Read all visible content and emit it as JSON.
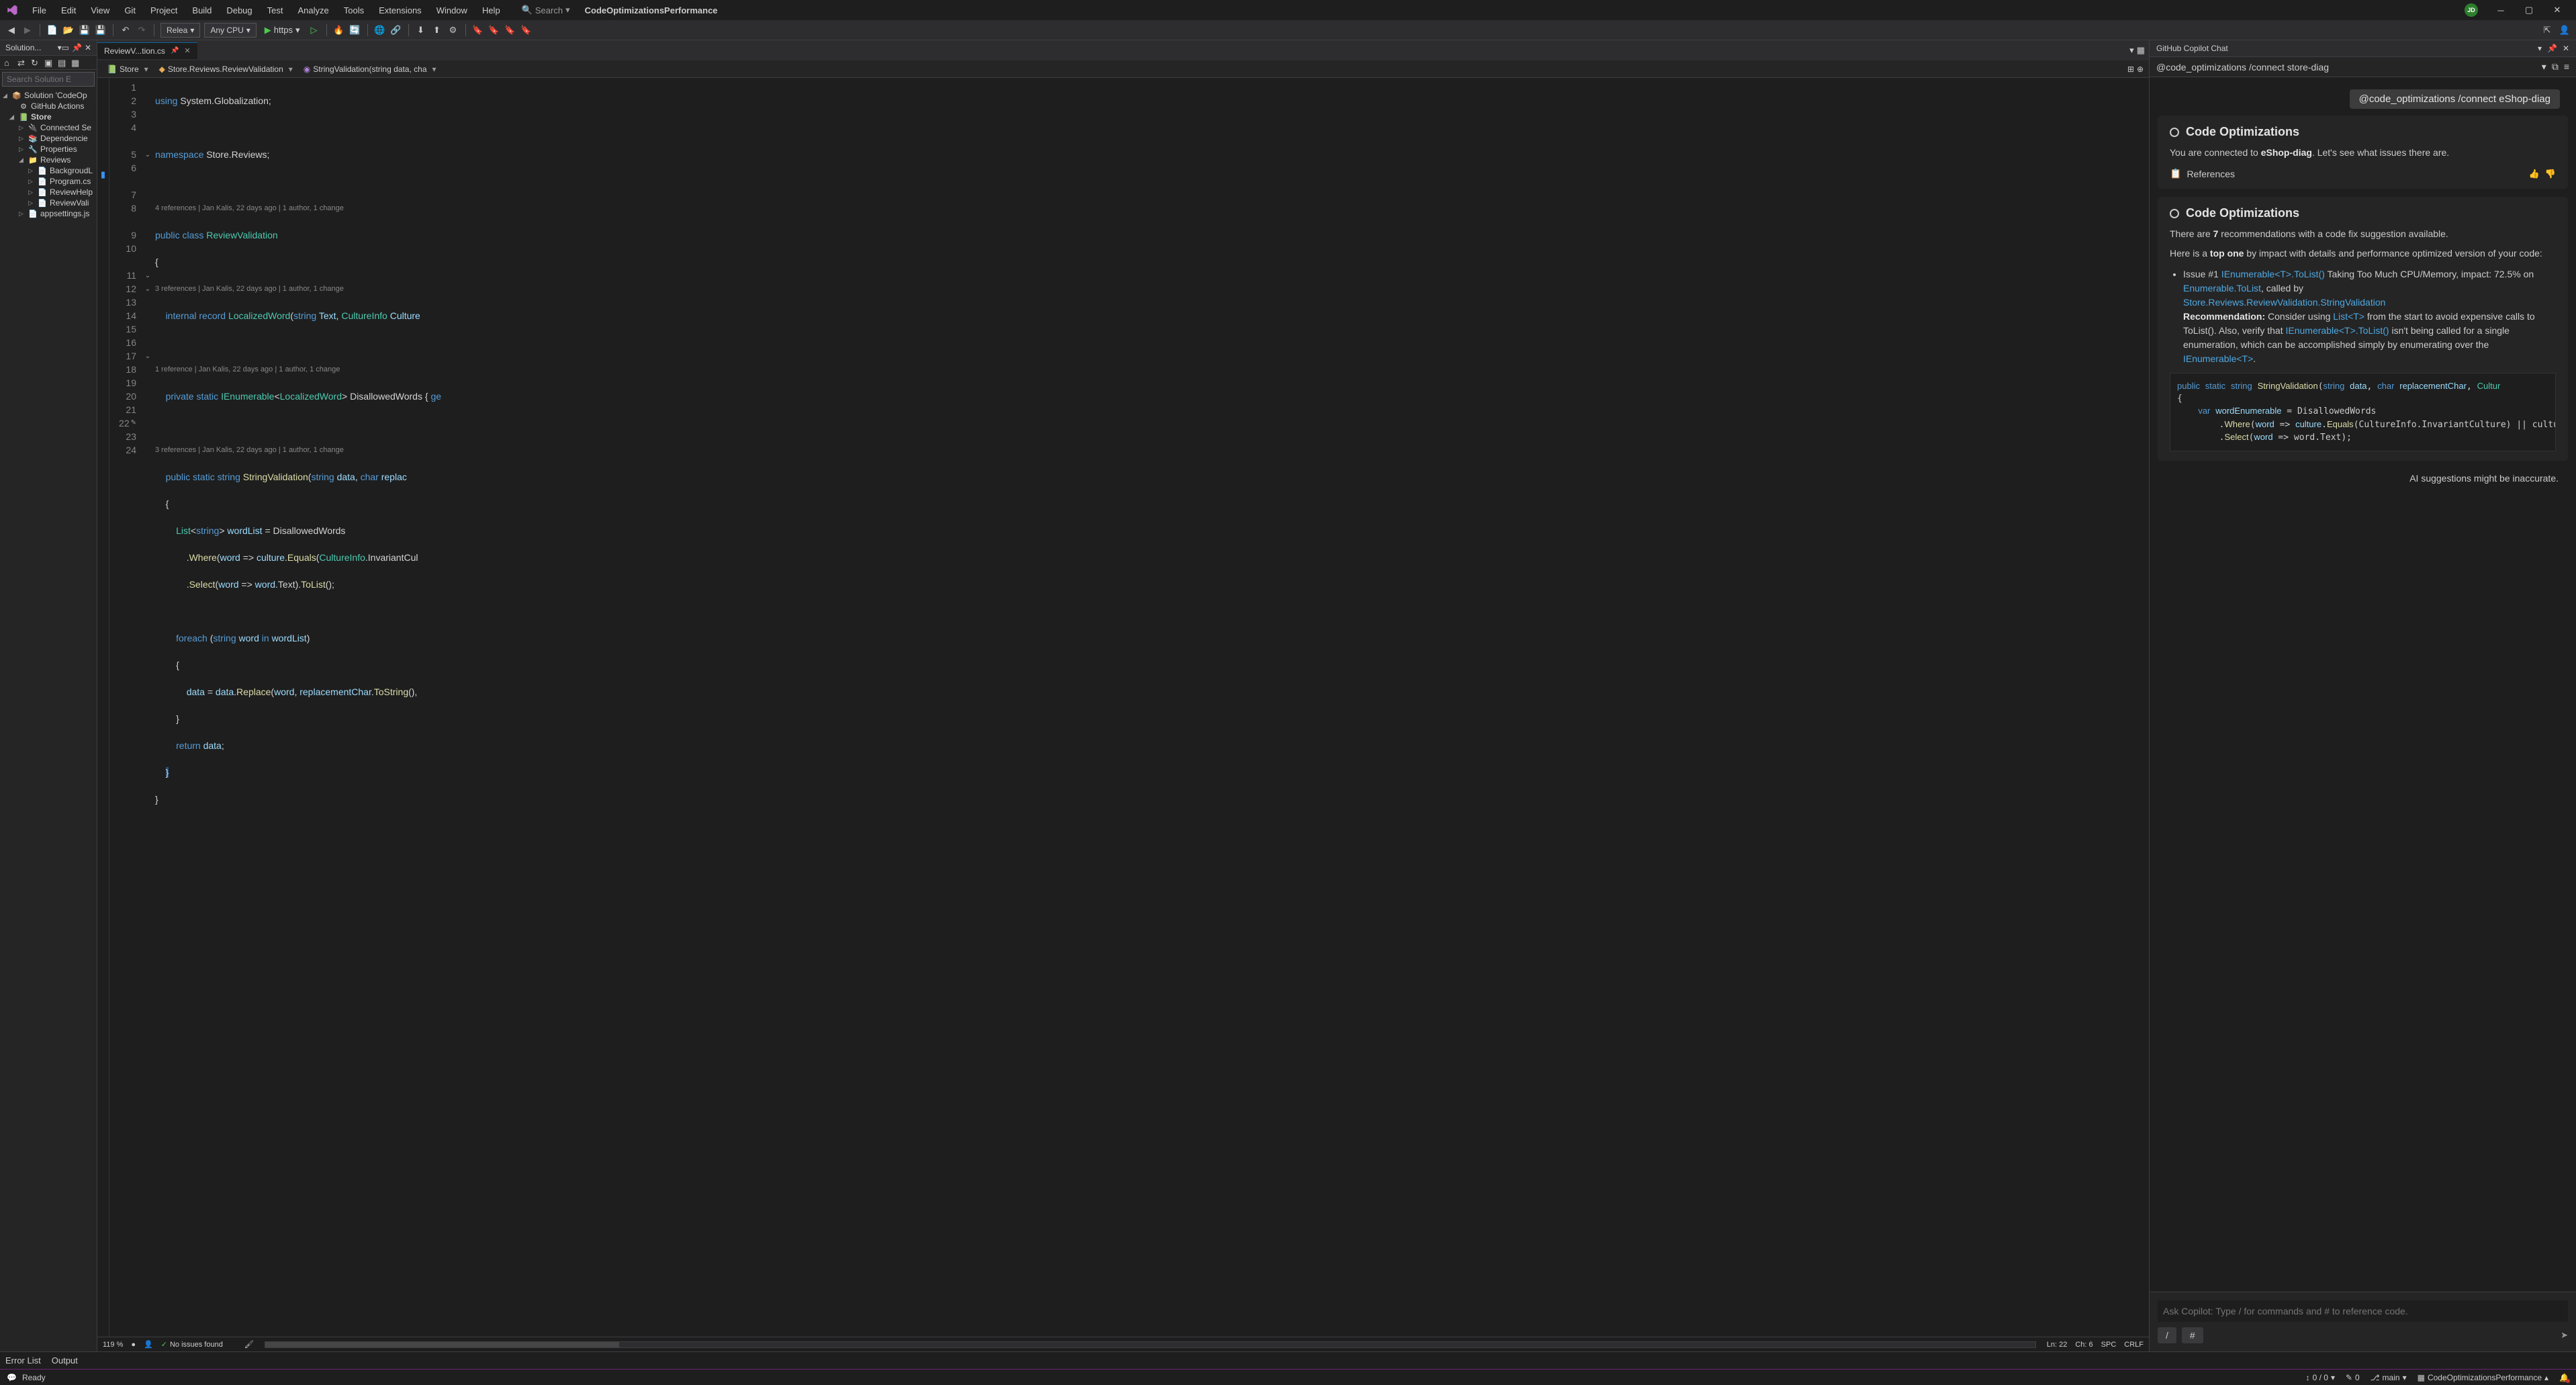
{
  "title_bar": {
    "menus": [
      "File",
      "Edit",
      "View",
      "Git",
      "Project",
      "Build",
      "Debug",
      "Test",
      "Analyze",
      "Tools",
      "Extensions",
      "Window",
      "Help"
    ],
    "search_placeholder": "Search",
    "project_name": "CodeOptimizationsPerformance",
    "user_initials": "JD"
  },
  "toolbar": {
    "config": "Relea",
    "platform": "Any CPU",
    "run_target": "https"
  },
  "solution_explorer": {
    "title": "Solution...",
    "search_placeholder": "Search Solution E",
    "solution": "Solution 'CodeOp",
    "github_actions": "GitHub Actions",
    "store": "Store",
    "connected": "Connected Se",
    "dependencies": "Dependencie",
    "properties": "Properties",
    "reviews": "Reviews",
    "background": "BackgroudL",
    "program": "Program.cs",
    "reviewhelp": "ReviewHelp",
    "reviewvali": "ReviewVali",
    "appsettings": "appsettings.js"
  },
  "editor": {
    "tab_name": "ReviewV...tion.cs",
    "breadcrumb1": "Store",
    "breadcrumb2": "Store.Reviews.ReviewValidation",
    "breadcrumb3": "StringValidation(string data, cha",
    "zoom": "119 %",
    "no_issues": "No issues found",
    "cursor_ln": "Ln: 22",
    "cursor_ch": "Ch: 6",
    "spaces": "SPC",
    "lineending": "CRLF",
    "codelens1": "4 references | Jan Kalis, 22 days ago | 1 author, 1 change",
    "codelens2": "3 references | Jan Kalis, 22 days ago | 1 author, 1 change",
    "codelens3": "1 reference | Jan Kalis, 22 days ago | 1 author, 1 change",
    "codelens4": "3 references | Jan Kalis, 22 days ago | 1 author, 1 change"
  },
  "copilot": {
    "title": "GitHub Copilot Chat",
    "prompt": "@code_optimizations /connect store-diag",
    "chip": "@code_optimizations /connect eShop-diag",
    "section_title": "Code Optimizations",
    "connected_pre": "You are connected to ",
    "connected_target": "eShop-diag",
    "connected_post": ". Let's see what issues there are.",
    "references": "References",
    "recs_pre": "There are ",
    "recs_count": "7",
    "recs_post": " recommendations with a code fix suggestion available.",
    "topone_pre": "Here is a ",
    "topone_bold": "top one",
    "topone_post": " by impact with details and performance optimized version of your code:",
    "issue_label": "Issue #1 ",
    "issue_api": "IEnumerable<T>.ToList()",
    "issue_text1": " Taking Too Much CPU/Memory, impact: 72.5% on ",
    "issue_api2": "Enumerable.ToList",
    "issue_text2": ", called by ",
    "issue_api3": "Store.Reviews.ReviewValidation.StringValidation",
    "rec_label": "Recommendation:",
    "rec_text1": " Consider using ",
    "rec_api1": "List<T>",
    "rec_text2": " from the start to avoid expensive calls to ToList(). Also, verify that ",
    "rec_api2": "IEnumerable<T>.ToList()",
    "rec_text3": " isn't being called for a single enumeration, which can be accomplished simply by enumerating over the ",
    "rec_api3": "IEnumerable<T>",
    "disclaimer": "AI suggestions might be inaccurate.",
    "input_placeholder": "Ask Copilot: Type / for commands and # to reference code.",
    "slash": "/",
    "hash": "#"
  },
  "output_tabs": {
    "error_list": "Error List",
    "output": "Output"
  },
  "status_bar": {
    "ready": "Ready",
    "nav": "0 / 0",
    "changes": "0",
    "branch": "main",
    "repo": "CodeOptimizationsPerformance"
  }
}
